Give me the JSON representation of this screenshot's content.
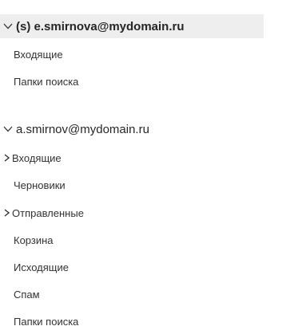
{
  "accounts": [
    {
      "label": "(s) e.smirnova@mydomain.ru",
      "folders": [
        {
          "label": "Входящие"
        },
        {
          "label": "Папки поиска"
        }
      ]
    },
    {
      "label": "a.smirnov@mydomain.ru",
      "folders": [
        {
          "label": "Входящие"
        },
        {
          "label": "Черновики"
        },
        {
          "label": "Отправленные"
        },
        {
          "label": "Корзина"
        },
        {
          "label": "Исходящие"
        },
        {
          "label": "Спам"
        },
        {
          "label": "Папки поиска"
        }
      ]
    }
  ],
  "icons": {
    "account_expander": "chevron-down-icon",
    "folder_expander": "chevron-right-icon"
  },
  "colors": {
    "selected_background": "#eeeeee",
    "text": "#262626"
  }
}
